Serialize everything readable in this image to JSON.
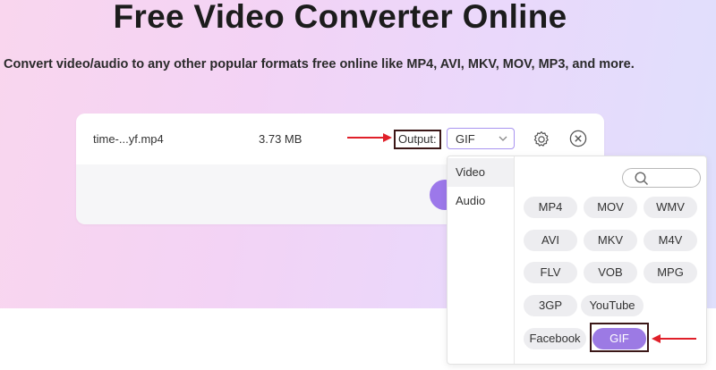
{
  "page": {
    "title": "Free Video Converter Online",
    "subtitle": "Convert video/audio to any other popular formats free online like MP4, AVI, MKV, MOV, MP3, and more."
  },
  "file": {
    "name": "time-...yf.mp4",
    "size": "3.73 MB",
    "output_label": "Output:",
    "output_format": "GIF"
  },
  "dropdown": {
    "categories": [
      "Video",
      "Audio"
    ],
    "active_category": "Video",
    "formats": [
      "MP4",
      "MOV",
      "WMV",
      "AVI",
      "MKV",
      "M4V",
      "FLV",
      "VOB",
      "MPG",
      "3GP",
      "YouTube",
      "Facebook",
      "GIF"
    ],
    "selected_format": "GIF"
  },
  "icons": {
    "settings": "gear-icon",
    "remove": "close-circle-icon",
    "search": "search-icon",
    "dropdown": "chevron-down-icon",
    "annotation": "red-arrow-icon"
  },
  "colors": {
    "accent": "#9c7ae4",
    "annotation_arrow": "#e0202a",
    "highlight_box": "#3b1717"
  }
}
